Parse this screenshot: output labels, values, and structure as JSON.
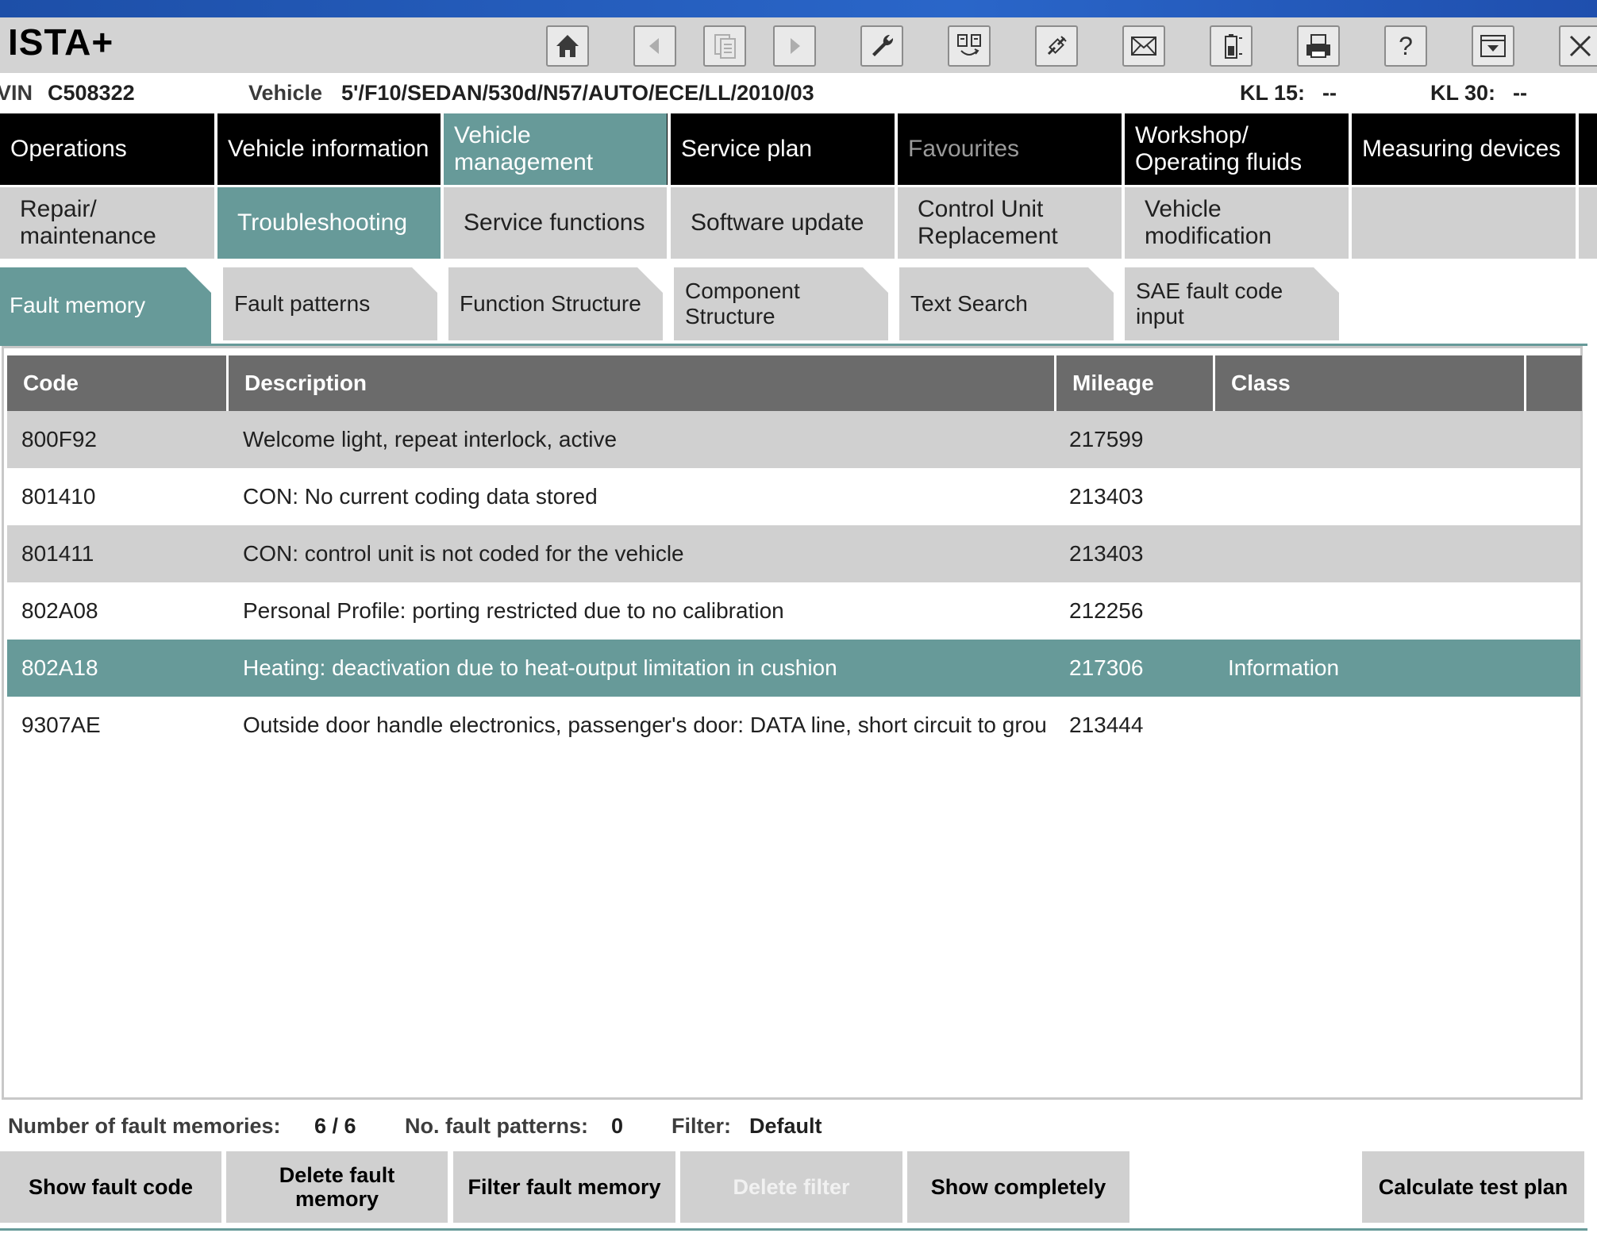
{
  "app": {
    "title": "ISTA+"
  },
  "toolbar": [
    {
      "name": "home-icon",
      "state": "enabled"
    },
    {
      "name": "back-arrow-icon",
      "state": "disabled"
    },
    {
      "name": "document-copy-icon",
      "state": "disabled"
    },
    {
      "name": "forward-arrow-icon",
      "state": "disabled"
    },
    {
      "name": "wrench-icon",
      "state": "enabled"
    },
    {
      "name": "swap-icon",
      "state": "enabled"
    },
    {
      "name": "connection-icon",
      "state": "enabled"
    },
    {
      "name": "envelope-icon",
      "state": "enabled"
    },
    {
      "name": "battery-icon",
      "state": "enabled"
    },
    {
      "name": "printer-icon",
      "state": "enabled"
    },
    {
      "name": "help-icon",
      "state": "enabled"
    },
    {
      "name": "minimize-window-icon",
      "state": "enabled"
    },
    {
      "name": "close-icon",
      "state": "enabled"
    }
  ],
  "info": {
    "vin_label": "VIN",
    "vin_value": "C508322",
    "vehicle_label": "Vehicle",
    "vehicle_value": "5'/F10/SEDAN/530d/N57/AUTO/ECE/LL/2010/03",
    "kl15_label": "KL 15:",
    "kl15_value": "--",
    "kl30_label": "KL 30:",
    "kl30_value": "--"
  },
  "nav_main": [
    {
      "label": "Operations",
      "state": "normal"
    },
    {
      "label": "Vehicle information",
      "state": "normal"
    },
    {
      "label": "Vehicle management",
      "state": "active"
    },
    {
      "label": "Service plan",
      "state": "normal"
    },
    {
      "label": "Favourites",
      "state": "dim"
    },
    {
      "label": "Workshop/ Operating fluids",
      "state": "normal"
    },
    {
      "label": "Measuring devices",
      "state": "normal"
    }
  ],
  "nav_sub": [
    {
      "label": "Repair/ maintenance",
      "state": "normal"
    },
    {
      "label": "Troubleshooting",
      "state": "active"
    },
    {
      "label": "Service functions",
      "state": "normal"
    },
    {
      "label": "Software update",
      "state": "normal"
    },
    {
      "label": "Control Unit Replacement",
      "state": "normal"
    },
    {
      "label": "Vehicle modification",
      "state": "normal"
    },
    {
      "label": "",
      "state": "normal"
    }
  ],
  "nav_tabs": [
    {
      "label": "Fault memory",
      "state": "active"
    },
    {
      "label": "Fault patterns",
      "state": "normal"
    },
    {
      "label": "Function Structure",
      "state": "normal"
    },
    {
      "label": "Component Structure",
      "state": "normal"
    },
    {
      "label": "Text Search",
      "state": "normal"
    },
    {
      "label": "SAE fault code input",
      "state": "normal"
    }
  ],
  "table": {
    "columns": [
      "Code",
      "Description",
      "Mileage",
      "Class",
      ""
    ],
    "rows": [
      {
        "code": "800F92",
        "description": "Welcome light, repeat interlock, active",
        "mileage": "217599",
        "class": "",
        "selected": false
      },
      {
        "code": "801410",
        "description": "CON: No current coding data stored",
        "mileage": "213403",
        "class": "",
        "selected": false
      },
      {
        "code": "801411",
        "description": "CON: control unit is not coded for the vehicle",
        "mileage": "213403",
        "class": "",
        "selected": false
      },
      {
        "code": "802A08",
        "description": "Personal Profile: porting restricted due to no calibration",
        "mileage": "212256",
        "class": "",
        "selected": false
      },
      {
        "code": "802A18",
        "description": "Heating: deactivation due to heat-output limitation in cushion",
        "mileage": "217306",
        "class": "Information",
        "selected": true
      },
      {
        "code": "9307AE",
        "description": "Outside door handle electronics, passenger's door: DATA line, short circuit to grou",
        "mileage": "213444",
        "class": "",
        "selected": false
      }
    ]
  },
  "status": {
    "fault_memories_label": "Number of fault memories:",
    "fault_memories_value": "6 / 6",
    "fault_patterns_label": "No. fault patterns:",
    "fault_patterns_value": "0",
    "filter_label": "Filter:",
    "filter_value": "Default"
  },
  "buttons": [
    {
      "label": "Show fault code",
      "state": "enabled"
    },
    {
      "label": "Delete fault memory",
      "state": "enabled"
    },
    {
      "label": "Filter fault memory",
      "state": "enabled"
    },
    {
      "label": "Delete filter",
      "state": "disabled"
    },
    {
      "label": "Show completely",
      "state": "enabled"
    },
    {
      "label": "Calculate test plan",
      "state": "enabled"
    }
  ],
  "colors": {
    "accent_teal": "#679a99",
    "nav_black": "#000000",
    "tab_gray": "#d0d0d0",
    "header_gray": "#6b6b6b",
    "title_blue": "#2a66c9"
  }
}
